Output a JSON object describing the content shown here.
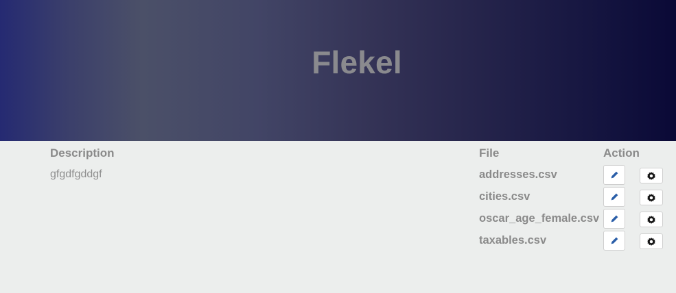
{
  "header": {
    "title": "Flekel"
  },
  "table": {
    "columns": {
      "description": "Description",
      "file": "File",
      "action": "Action"
    },
    "description_value": "gfgdfgddgf",
    "files": [
      "addresses.csv",
      "cities.csv",
      "oscar_age_female.csv",
      "taxables.csv"
    ]
  },
  "icons": {
    "edit": "pencil-icon",
    "settings": "gear-icon"
  },
  "colors": {
    "edit_icon": "#2a5ea8",
    "gear_icon": "#111111"
  }
}
